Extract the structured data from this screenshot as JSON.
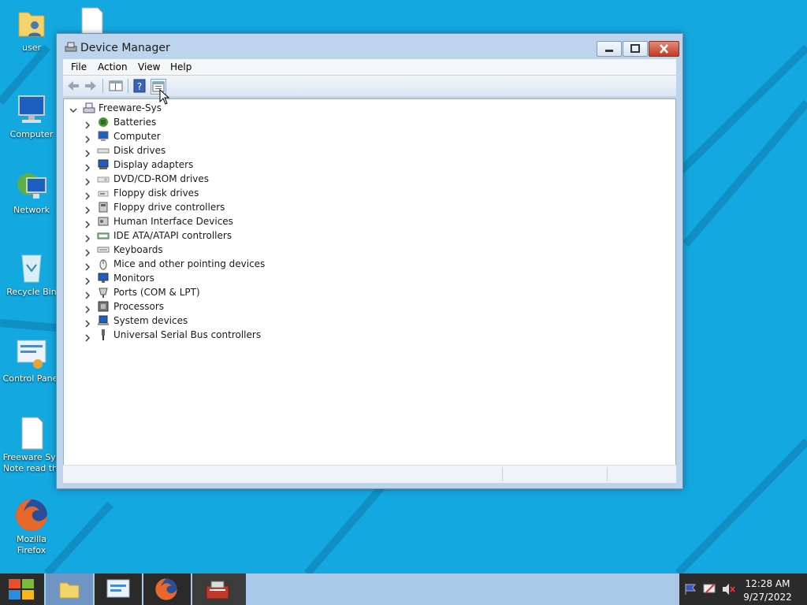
{
  "desktop": {
    "icons": [
      {
        "label": "user"
      },
      {
        "label": "Computer"
      },
      {
        "label": "Network"
      },
      {
        "label": "Recycle Bin"
      },
      {
        "label": "Control Panel"
      },
      {
        "label_line1": "Freeware Sys",
        "label_line2": "Note read thi"
      },
      {
        "label_line1": "Mozilla",
        "label_line2": "Firefox"
      }
    ]
  },
  "window": {
    "title": "Device Manager",
    "menu": [
      "File",
      "Action",
      "View",
      "Help"
    ],
    "toolbar_icons": [
      "back-arrow-icon",
      "forward-arrow-icon",
      "show-hide-console-tree-icon",
      "help-icon",
      "properties-icon"
    ],
    "tree": {
      "root": "Freeware-Sys",
      "categories": [
        {
          "label": "Batteries",
          "icon": "battery-icon"
        },
        {
          "label": "Computer",
          "icon": "computer-icon"
        },
        {
          "label": "Disk drives",
          "icon": "disk-drive-icon"
        },
        {
          "label": "Display adapters",
          "icon": "display-adapter-icon"
        },
        {
          "label": "DVD/CD-ROM drives",
          "icon": "dvd-drive-icon"
        },
        {
          "label": "Floppy disk drives",
          "icon": "floppy-drive-icon"
        },
        {
          "label": "Floppy drive controllers",
          "icon": "floppy-controller-icon"
        },
        {
          "label": "Human Interface Devices",
          "icon": "hid-icon"
        },
        {
          "label": "IDE ATA/ATAPI controllers",
          "icon": "ide-controller-icon"
        },
        {
          "label": "Keyboards",
          "icon": "keyboard-icon"
        },
        {
          "label": "Mice and other pointing devices",
          "icon": "mouse-icon"
        },
        {
          "label": "Monitors",
          "icon": "monitor-icon"
        },
        {
          "label": "Ports (COM & LPT)",
          "icon": "port-icon"
        },
        {
          "label": "Processors",
          "icon": "processor-icon"
        },
        {
          "label": "System devices",
          "icon": "system-device-icon"
        },
        {
          "label": "Universal Serial Bus controllers",
          "icon": "usb-icon"
        }
      ]
    }
  },
  "taskbar": {
    "apps": [
      "file-explorer-icon",
      "control-panel-icon",
      "firefox-icon",
      "device-manager-icon"
    ],
    "tray_icons": [
      "flag-icon",
      "network-icon",
      "volume-muted-icon"
    ],
    "clock": {
      "time": "12:28 AM",
      "date": "9/27/2022"
    }
  },
  "colors": {
    "desktop": "#14a8e0",
    "window_frame": "#bcd5ec",
    "close_button": "#c94a35",
    "taskbar": "#a9c7e6"
  }
}
